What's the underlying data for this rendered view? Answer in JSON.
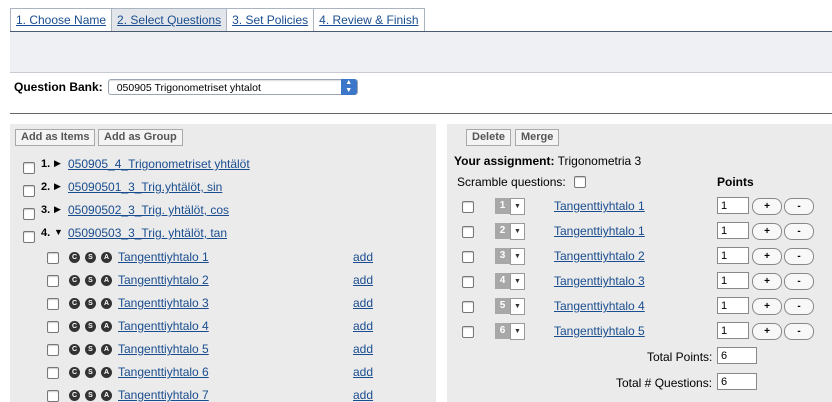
{
  "tabs": [
    {
      "label": "1. Choose Name"
    },
    {
      "label": "2. Select Questions"
    },
    {
      "label": "3. Set Policies"
    },
    {
      "label": "4. Review & Finish"
    }
  ],
  "question_bank": {
    "label": "Question Bank:",
    "selected": "050905 Trigonometriset yhtalot"
  },
  "left": {
    "add_items_label": "Add as Items",
    "add_group_label": "Add as Group",
    "pools": [
      {
        "num": "1.",
        "name": "050905_4_Trigonometriset yhtälöt"
      },
      {
        "num": "2.",
        "name": "05090501_3_Trig.yhtälöt, sin"
      },
      {
        "num": "3.",
        "name": "05090502_3_Trig. yhtälöt, cos"
      },
      {
        "num": "4.",
        "name": "05090503_3_Trig. yhtälöt, tan"
      }
    ],
    "items": [
      {
        "name": "Tangenttiyhtalo 1",
        "add": "add"
      },
      {
        "name": "Tangenttiyhtalo 2",
        "add": "add"
      },
      {
        "name": "Tangenttiyhtalo 3",
        "add": "add"
      },
      {
        "name": "Tangenttiyhtalo 4",
        "add": "add"
      },
      {
        "name": "Tangenttiyhtalo 5",
        "add": "add"
      },
      {
        "name": "Tangenttiyhtalo 6",
        "add": "add"
      },
      {
        "name": "Tangenttiyhtalo 7",
        "add": "add"
      }
    ],
    "badges": [
      "C",
      "S",
      "A"
    ]
  },
  "right": {
    "delete_label": "Delete",
    "merge_label": "Merge",
    "assignment_label": "Your assignment:",
    "assignment_name": "Trigonometria 3",
    "scramble_label": "Scramble questions:",
    "points_header": "Points",
    "plus": "+",
    "minus": "-",
    "rows": [
      {
        "order": "1",
        "name": "Tangenttiyhtalo 1",
        "points": "1"
      },
      {
        "order": "2",
        "name": "Tangenttiyhtalo 1",
        "points": "1"
      },
      {
        "order": "3",
        "name": "Tangenttiyhtalo 2",
        "points": "1"
      },
      {
        "order": "4",
        "name": "Tangenttiyhtalo 3",
        "points": "1"
      },
      {
        "order": "5",
        "name": "Tangenttiyhtalo 4",
        "points": "1"
      },
      {
        "order": "6",
        "name": "Tangenttiyhtalo 5",
        "points": "1"
      }
    ],
    "total_points_label": "Total Points:",
    "total_points": "6",
    "total_questions_label": "Total # Questions:",
    "total_questions": "6"
  }
}
